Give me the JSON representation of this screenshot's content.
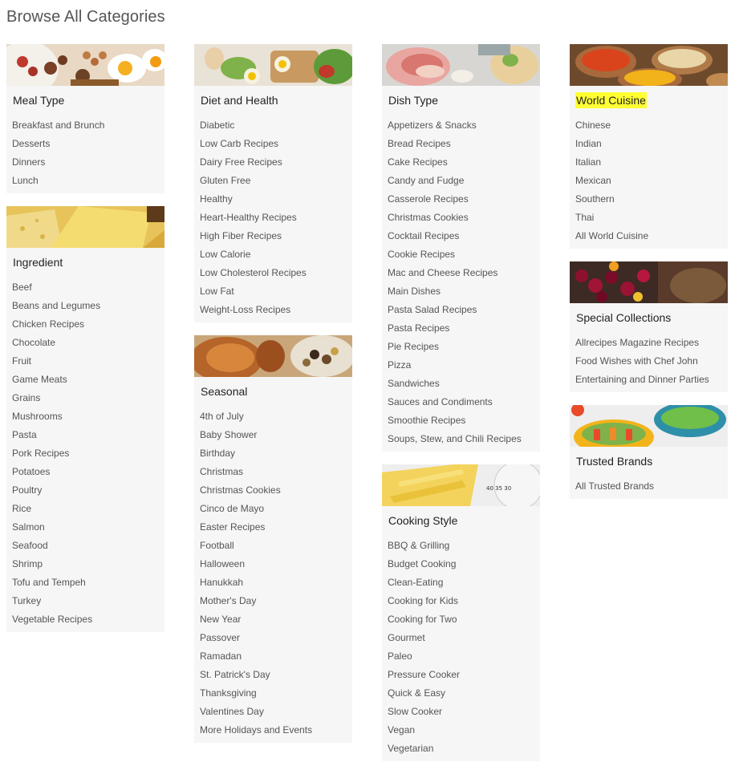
{
  "page": {
    "title": "Browse All Categories"
  },
  "columns": [
    {
      "cards": [
        {
          "id": "meal-type",
          "title": "Meal Type",
          "highlight": false,
          "items": [
            "Breakfast and Brunch",
            "Desserts",
            "Dinners",
            "Lunch"
          ]
        },
        {
          "id": "ingredient",
          "title": "Ingredient",
          "highlight": false,
          "items": [
            "Beef",
            "Beans and Legumes",
            "Chicken Recipes",
            "Chocolate",
            "Fruit",
            "Game Meats",
            "Grains",
            "Mushrooms",
            "Pasta",
            "Pork Recipes",
            "Potatoes",
            "Poultry",
            "Rice",
            "Salmon",
            "Seafood",
            "Shrimp",
            "Tofu and Tempeh",
            "Turkey",
            "Vegetable Recipes"
          ]
        }
      ]
    },
    {
      "cards": [
        {
          "id": "diet-and-health",
          "title": "Diet and Health",
          "highlight": false,
          "items": [
            "Diabetic",
            "Low Carb Recipes",
            "Dairy Free Recipes",
            "Gluten Free",
            "Healthy",
            "Heart-Healthy Recipes",
            "High Fiber Recipes",
            "Low Calorie",
            "Low Cholesterol Recipes",
            "Low Fat",
            "Weight-Loss Recipes"
          ]
        },
        {
          "id": "seasonal",
          "title": "Seasonal",
          "highlight": false,
          "items": [
            "4th of July",
            "Baby Shower",
            "Birthday",
            "Christmas",
            "Christmas Cookies",
            "Cinco de Mayo",
            "Easter Recipes",
            "Football",
            "Halloween",
            "Hanukkah",
            "Mother's Day",
            "New Year",
            "Passover",
            "Ramadan",
            "St. Patrick's Day",
            "Thanksgiving",
            "Valentines Day",
            "More Holidays and Events"
          ]
        }
      ]
    },
    {
      "cards": [
        {
          "id": "dish-type",
          "title": "Dish Type",
          "highlight": false,
          "items": [
            "Appetizers & Snacks",
            "Bread Recipes",
            "Cake Recipes",
            "Candy and Fudge",
            "Casserole Recipes",
            "Christmas Cookies",
            "Cocktail Recipes",
            "Cookie Recipes",
            "Mac and Cheese Recipes",
            "Main Dishes",
            "Pasta Salad Recipes",
            "Pasta Recipes",
            "Pie Recipes",
            "Pizza",
            "Sandwiches",
            "Sauces and Condiments",
            "Smoothie Recipes",
            "Soups, Stew, and Chili Recipes"
          ]
        },
        {
          "id": "cooking-style",
          "title": "Cooking Style",
          "highlight": false,
          "items": [
            "BBQ & Grilling",
            "Budget Cooking",
            "Clean-Eating",
            "Cooking for Kids",
            "Cooking for Two",
            "Gourmet",
            "Paleo",
            "Pressure Cooker",
            "Quick & Easy",
            "Slow Cooker",
            "Vegan",
            "Vegetarian"
          ]
        }
      ]
    },
    {
      "cards": [
        {
          "id": "world-cuisine",
          "title": "World Cuisine",
          "highlight": true,
          "items": [
            "Chinese",
            "Indian",
            "Italian",
            "Mexican",
            "Southern",
            "Thai",
            "All World Cuisine"
          ]
        },
        {
          "id": "special-collections",
          "title": "Special Collections",
          "highlight": false,
          "items": [
            "Allrecipes Magazine Recipes",
            "Food Wishes with Chef John",
            "Entertaining and Dinner Parties"
          ]
        },
        {
          "id": "trusted-brands",
          "title": "Trusted Brands",
          "highlight": false,
          "items": [
            "All Trusted Brands"
          ]
        }
      ]
    }
  ],
  "colors": {
    "card_bg": "#f6f6f6",
    "highlight": "#ffff33",
    "link": "#555555",
    "title": "#222222"
  }
}
